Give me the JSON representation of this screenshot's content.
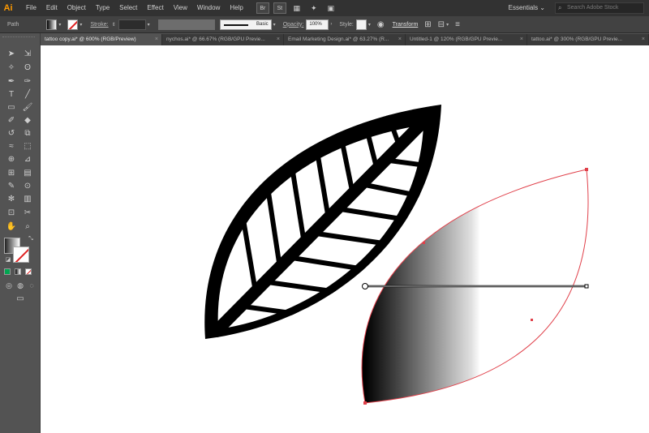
{
  "app": {
    "logo": "Ai"
  },
  "menu": [
    "File",
    "Edit",
    "Object",
    "Type",
    "Select",
    "Effect",
    "View",
    "Window",
    "Help"
  ],
  "menubar_buttons": [
    "Br",
    "St"
  ],
  "workspace": "Essentials ⌄",
  "search": {
    "placeholder": "Search Adobe Stock"
  },
  "control": {
    "selection_label": "Path",
    "stroke_label": "Stroke:",
    "brush_label": "Basic",
    "opacity_label": "Opacity:",
    "opacity_value": "100%",
    "style_label": "Style:",
    "transform_label": "Transform"
  },
  "tabs": [
    {
      "label": "tattoo copy.ai* @ 600% (RGB/Preview)",
      "active": true
    },
    {
      "label": "nychos.ai* @ 66.67% (RGB/GPU Previe...",
      "active": false
    },
    {
      "label": "Email Marketing Design.ai* @ 63.27% (R...",
      "active": false
    },
    {
      "label": "Untitled-1 @ 120% (RGB/GPU Previe...",
      "active": false
    },
    {
      "label": "tattoo.ai* @ 300% (RGB/GPU Previe...",
      "active": false
    }
  ],
  "tab_close": "×",
  "colors": {
    "accent_logo": "#ff9a00",
    "selection_path": "#e0404a",
    "gradient_start": "#000000",
    "gradient_end": "#ffffff",
    "fill_swatch_green": "#00a651"
  },
  "tools": [
    "selection-icon",
    "direct-selection-icon",
    "magic-wand-icon",
    "lasso-icon",
    "pen-icon",
    "curvature-icon",
    "type-icon",
    "line-icon",
    "rectangle-icon",
    "paintbrush-icon",
    "shaper-icon",
    "eraser-icon",
    "rotate-icon",
    "scale-icon",
    "warp-icon",
    "free-transform-icon",
    "shape-builder-icon",
    "perspective-icon",
    "mesh-icon",
    "gradient-icon",
    "eyedropper-icon",
    "blend-icon",
    "symbol-sprayer-icon",
    "graph-icon",
    "artboard-icon",
    "slice-icon",
    "hand-icon",
    "zoom-icon"
  ]
}
